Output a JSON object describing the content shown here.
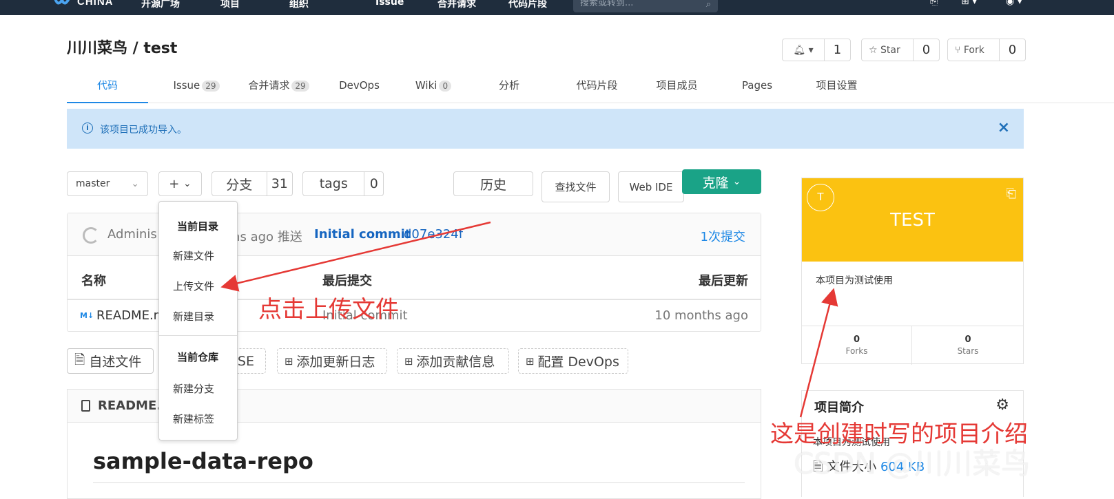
{
  "topnav": {
    "brand": "CHINA",
    "items": [
      "开源广场",
      "项目",
      "组织",
      "Issue",
      "合并请求",
      "代码片段"
    ],
    "search_placeholder": "搜索或转到..."
  },
  "project": {
    "title": "川川菜鸟 / test",
    "watch_count": "1",
    "star_label": "Star",
    "star_count": "0",
    "fork_label": "Fork",
    "fork_count": "0"
  },
  "tabs": [
    {
      "label": "代码",
      "badge": ""
    },
    {
      "label": "Issue",
      "badge": "29"
    },
    {
      "label": "合并请求",
      "badge": "29"
    },
    {
      "label": "DevOps",
      "badge": ""
    },
    {
      "label": "Wiki",
      "badge": "0"
    },
    {
      "label": "分析",
      "badge": ""
    },
    {
      "label": "代码片段",
      "badge": ""
    },
    {
      "label": "项目成员",
      "badge": ""
    },
    {
      "label": "Pages",
      "badge": ""
    },
    {
      "label": "项目设置",
      "badge": ""
    }
  ],
  "alert": {
    "text": "该项目已成功导入。"
  },
  "toolbar": {
    "branch": "master",
    "add": "+",
    "branches_label": "分支",
    "branches_count": "31",
    "tags_label": "tags",
    "tags_count": "0",
    "history": "历史",
    "find_file": "查找文件",
    "web_ide": "Web IDE",
    "clone": "克隆"
  },
  "dropdown": {
    "section1": "当前目录",
    "items1": [
      "新建文件",
      "上传文件",
      "新建目录"
    ],
    "section2": "当前仓库",
    "items2": [
      "新建分支",
      "新建标签"
    ]
  },
  "commit": {
    "author": "Adminis",
    "ago": "ths ago 推送",
    "message": "Initial commit",
    "hash": "d07e324f",
    "count": "1次提交"
  },
  "file_table": {
    "headers": [
      "名称",
      "最后提交",
      "最后更新"
    ],
    "rows": [
      {
        "name": "README.m",
        "commit": "Initial commit",
        "updated": "10 months ago"
      }
    ]
  },
  "doc_buttons": [
    "自述文件",
    "NSE",
    "添加更新日志",
    "添加贡献信息",
    "配置 DevOps"
  ],
  "readme": {
    "filename": "README.",
    "heading": "sample-data-repo"
  },
  "card": {
    "initial": "T",
    "title": "TEST",
    "description": "本项目为测试使用",
    "forks": "0",
    "forks_label": "Forks",
    "stars": "0",
    "stars_label": "Stars"
  },
  "intro": {
    "heading": "项目简介",
    "description": "本项目为测试使用",
    "size_label": "文件大小",
    "size_value": "604 KB"
  },
  "annotations": {
    "upload_hint": "点击上传文件",
    "intro_hint": "这是创建时写的项目介绍"
  },
  "watermark": "CSDN @川川菜鸟",
  "colors": {
    "accent": "#1e88e5",
    "clone": "#1aa387",
    "card_banner": "#fbc211",
    "annotation": "#e53935"
  }
}
